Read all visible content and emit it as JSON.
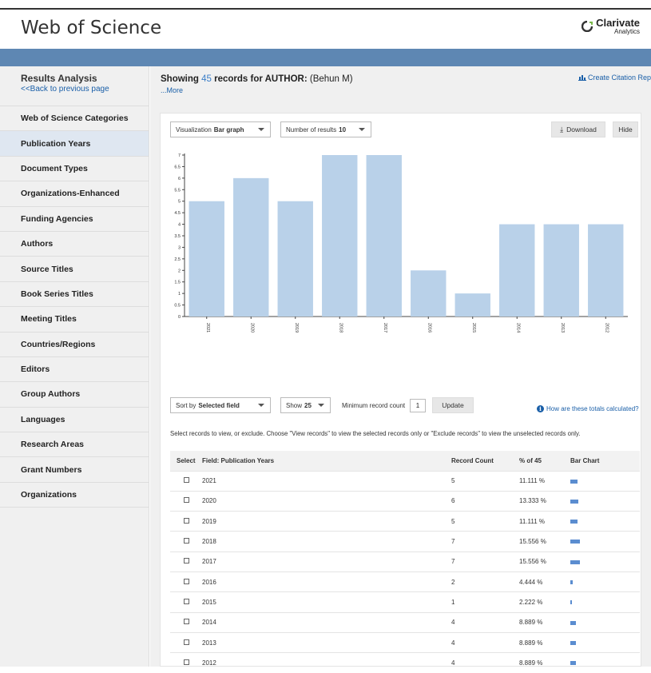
{
  "header": {
    "app_title": "Web of Science",
    "brand_name": "Clarivate",
    "brand_sub": "Analytics"
  },
  "sidebar": {
    "title": "Results Analysis",
    "back_link": "<<Back to previous page",
    "items": [
      {
        "label": "Web of Science Categories",
        "active": false
      },
      {
        "label": "Publication Years",
        "active": true
      },
      {
        "label": "Document Types",
        "active": false
      },
      {
        "label": "Organizations-Enhanced",
        "active": false
      },
      {
        "label": "Funding Agencies",
        "active": false
      },
      {
        "label": "Authors",
        "active": false
      },
      {
        "label": "Source Titles",
        "active": false
      },
      {
        "label": "Book Series Titles",
        "active": false
      },
      {
        "label": "Meeting Titles",
        "active": false
      },
      {
        "label": "Countries/Regions",
        "active": false
      },
      {
        "label": "Editors",
        "active": false
      },
      {
        "label": "Group Authors",
        "active": false
      },
      {
        "label": "Languages",
        "active": false
      },
      {
        "label": "Research Areas",
        "active": false
      },
      {
        "label": "Grant Numbers",
        "active": false
      },
      {
        "label": "Organizations",
        "active": false
      }
    ]
  },
  "summary": {
    "prefix": "Showing",
    "count": "45",
    "mid": "records for",
    "field": "AUTHOR:",
    "query": "(Behun M)",
    "more": "...More",
    "citation_link": "Create Citation Repor"
  },
  "controls": {
    "viz_label": "Visualization",
    "viz_value": "Bar graph",
    "num_label": "Number of results",
    "num_value": "10",
    "download": "Download",
    "hide": "Hide",
    "sort_label": "Sort by",
    "sort_value": "Selected field",
    "show_label": "Show",
    "show_value": "25",
    "min_label": "Minimum record count",
    "min_value": "1",
    "update": "Update",
    "how_calc": "How are these totals calculated?"
  },
  "instructions": "Select records to view, or exclude. Choose \"View records\" to view the selected records only or \"Exclude records\" to view the unselected records only.",
  "table": {
    "headers": [
      "Select",
      "Field: Publication Years",
      "Record Count",
      "% of 45",
      "Bar Chart"
    ],
    "rows": [
      {
        "year": "2021",
        "count": "5",
        "pct": "11.111 %",
        "value": 5
      },
      {
        "year": "2020",
        "count": "6",
        "pct": "13.333 %",
        "value": 6
      },
      {
        "year": "2019",
        "count": "5",
        "pct": "11.111 %",
        "value": 5
      },
      {
        "year": "2018",
        "count": "7",
        "pct": "15.556 %",
        "value": 7
      },
      {
        "year": "2017",
        "count": "7",
        "pct": "15.556 %",
        "value": 7
      },
      {
        "year": "2016",
        "count": "2",
        "pct": "4.444 %",
        "value": 2
      },
      {
        "year": "2015",
        "count": "1",
        "pct": "2.222 %",
        "value": 1
      },
      {
        "year": "2014",
        "count": "4",
        "pct": "8.889 %",
        "value": 4
      },
      {
        "year": "2013",
        "count": "4",
        "pct": "8.889 %",
        "value": 4
      },
      {
        "year": "2012",
        "count": "4",
        "pct": "8.889 %",
        "value": 4
      }
    ]
  },
  "colors": {
    "bar": "#b9d1e9",
    "mini_bar": "#5b8dd0",
    "accent": "#5e87b3",
    "link": "#1a5fa8"
  },
  "chart_data": {
    "type": "bar",
    "categories": [
      "2021",
      "2020",
      "2019",
      "2018",
      "2017",
      "2016",
      "2015",
      "2014",
      "2013",
      "2012"
    ],
    "values": [
      5,
      6,
      5,
      7,
      7,
      2,
      1,
      4,
      4,
      4
    ],
    "ylim": [
      0,
      7
    ],
    "yticks": [
      "0",
      "0.5",
      "1",
      "1.5",
      "2",
      "2.5",
      "3",
      "3.5",
      "4",
      "4.5",
      "5",
      "5.5",
      "6",
      "6.5",
      "7"
    ],
    "grid": false,
    "title": "",
    "xlabel": "",
    "ylabel": ""
  }
}
